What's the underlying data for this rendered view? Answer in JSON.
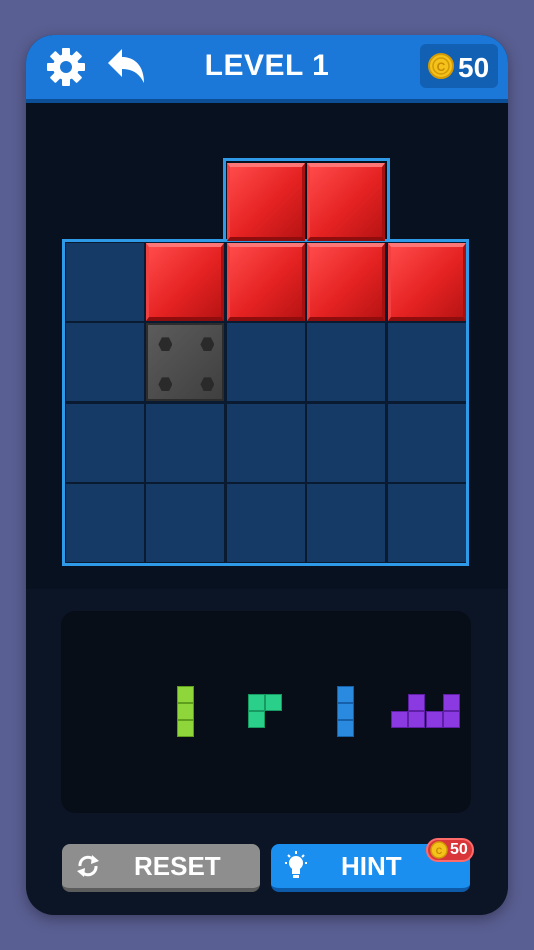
{
  "header": {
    "settings_icon": "gear-icon",
    "back_icon": "undo-arrow-icon",
    "level_title": "LEVEL 1",
    "coins": "50"
  },
  "board": {
    "rows": 4,
    "cols": 5,
    "red_blocks": [
      {
        "row": -1,
        "col": 2
      },
      {
        "row": -1,
        "col": 3
      },
      {
        "row": 0,
        "col": 1
      },
      {
        "row": 0,
        "col": 2
      },
      {
        "row": 0,
        "col": 3
      },
      {
        "row": 0,
        "col": 4
      }
    ],
    "stone_blocks": [
      {
        "row": 1,
        "col": 1
      }
    ]
  },
  "tray": {
    "pieces": [
      {
        "name": "lime-i-piece",
        "color": "#8fd63a"
      },
      {
        "name": "green-l-piece",
        "color": "#2ad08a"
      },
      {
        "name": "blue-i-piece",
        "color": "#2a8ae0"
      },
      {
        "name": "purple-piece",
        "color": "#8a3ae0"
      }
    ]
  },
  "buttons": {
    "reset_label": "RESET",
    "hint_label": "HINT",
    "hint_cost": "50"
  },
  "colors": {
    "accent": "#1b78d8",
    "grid_outline": "#2f9ae8",
    "red_block": "#e52222"
  }
}
